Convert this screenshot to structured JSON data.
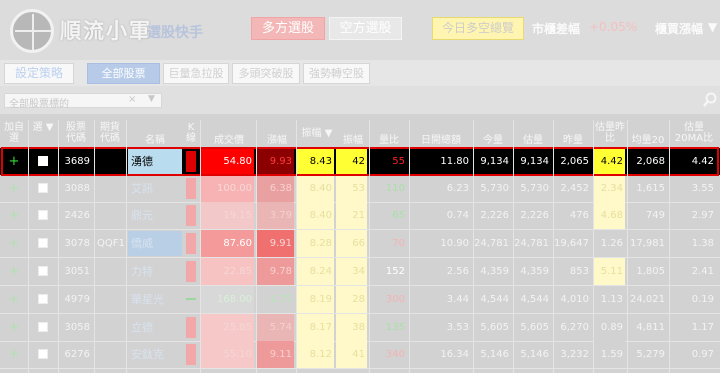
{
  "header": {
    "logo_text": "順流小軍",
    "logo_sub": "選股快手",
    "btn_long": "多方選股",
    "btn_short": "空方選股",
    "btn_today": "今日多空總覽",
    "market_label": "市櫃差幅",
    "market_value": "+0.05%",
    "rank_label": "櫃買漲幅",
    "rank_caret": "▼"
  },
  "toolbar": {
    "setting": "設定策略",
    "all": "全部股票",
    "filter1": "巨量急拉股",
    "filter2": "多頭突破股",
    "filter3": "強勢轉空股"
  },
  "filter": {
    "text": "全部股票標的",
    "clear": "×",
    "caret": "▼"
  },
  "columns": [
    "加自選",
    "選 ▼",
    "股票代碼",
    "期貨代碼",
    "名稱",
    "K線",
    "成交價",
    "漲幅",
    "振幅 ▼",
    "振幅",
    "量比",
    "日開總額",
    "今量",
    "估量",
    "昨量",
    "估量昨比",
    "均量20",
    "估量20MA比"
  ],
  "rows": [
    {
      "add": "+",
      "code": "3689",
      "fut": "",
      "name": "湧德",
      "price": "54.80",
      "chg": "9.93",
      "amp": "8.43",
      "amp2": "42",
      "ratio": "55",
      "turn": "11.80",
      "vol": "9,134",
      "est": "9,134",
      "prev": "2,065",
      "estr": "4.42",
      "ma20": "2,068",
      "ma20r": "4.42"
    },
    {
      "add": "+",
      "code": "3088",
      "fut": "",
      "name": "艾訊",
      "price": "100.00",
      "chg": "6.38",
      "amp": "8.40",
      "amp2": "53",
      "ratio": "110",
      "turn": "6.23",
      "vol": "5,730",
      "est": "5,730",
      "prev": "2,452",
      "estr": "2.34",
      "ma20": "1,615",
      "ma20r": "3.55"
    },
    {
      "add": "+",
      "code": "2426",
      "fut": "",
      "name": "鼎元",
      "price": "19.15",
      "chg": "3.79",
      "amp": "8.40",
      "amp2": "21",
      "ratio": "65",
      "turn": "0.74",
      "vol": "2,226",
      "est": "2,226",
      "prev": "476",
      "estr": "4.68",
      "ma20": "749",
      "ma20r": "2.97"
    },
    {
      "add": "+",
      "code": "3078",
      "fut": "QQF1",
      "name": "僑威",
      "price": "87.60",
      "chg": "9.91",
      "amp": "8.28",
      "amp2": "66",
      "ratio": "70",
      "turn": "10.90",
      "vol": "24,781",
      "est": "24,781",
      "prev": "19,647",
      "estr": "1.26",
      "ma20": "17,981",
      "ma20r": "1.38"
    },
    {
      "add": "+",
      "code": "3051",
      "fut": "",
      "name": "力特",
      "price": "22.85",
      "chg": "9.78",
      "amp": "8.24",
      "amp2": "34",
      "ratio": "152",
      "turn": "2.56",
      "vol": "4,359",
      "est": "4,359",
      "prev": "853",
      "estr": "5.11",
      "ma20": "1,805",
      "ma20r": "2.41"
    },
    {
      "add": "+",
      "code": "4979",
      "fut": "",
      "name": "華星光",
      "price": "168.00",
      "chg": "-1.75",
      "amp": "8.19",
      "amp2": "28",
      "ratio": "300",
      "turn": "3.44",
      "vol": "4,544",
      "est": "4,544",
      "prev": "4,010",
      "estr": "1.13",
      "ma20": "24,021",
      "ma20r": "0.19"
    },
    {
      "add": "+",
      "code": "3058",
      "fut": "",
      "name": "立德",
      "price": "25.85",
      "chg": "5.74",
      "amp": "8.17",
      "amp2": "38",
      "ratio": "135",
      "turn": "3.53",
      "vol": "5,605",
      "est": "5,605",
      "prev": "6,270",
      "estr": "0.89",
      "ma20": "4,811",
      "ma20r": "1.17"
    },
    {
      "add": "+",
      "code": "6276",
      "fut": "",
      "name": "安鈦克",
      "price": "55.10",
      "chg": "9.11",
      "amp": "8.12",
      "amp2": "41",
      "ratio": "340",
      "turn": "16.34",
      "vol": "5,146",
      "est": "5,146",
      "prev": "3,232",
      "estr": "1.59",
      "ma20": "5,279",
      "ma20r": "0.97"
    }
  ]
}
